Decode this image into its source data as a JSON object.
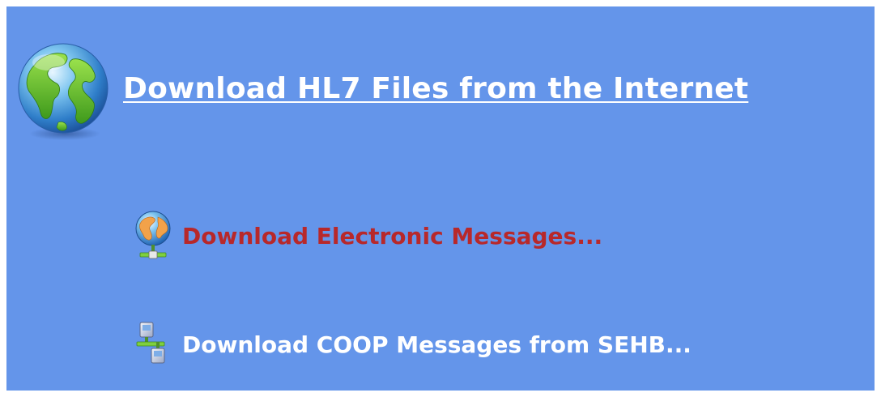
{
  "header": {
    "title": "Download HL7 Files from the Internet",
    "icon": "globe-icon"
  },
  "links": [
    {
      "label": "Download Electronic Messages...",
      "icon": "network-globe-icon",
      "state": "hover",
      "color": "#b8282a"
    },
    {
      "label": "Download COOP Messages from SEHB...",
      "icon": "network-computers-icon",
      "state": "normal",
      "color": "#ffffff"
    }
  ],
  "colors": {
    "background": "#6495ea",
    "frame": "#ffffff"
  }
}
